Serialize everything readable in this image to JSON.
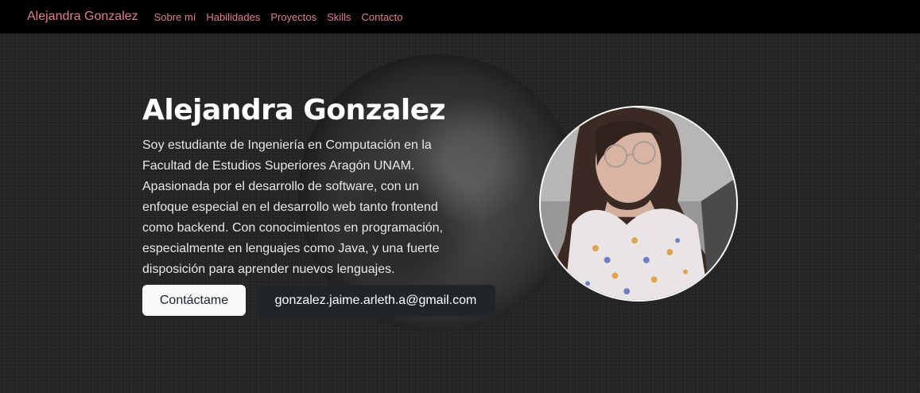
{
  "nav": {
    "brand": "Alejandra Gonzalez",
    "links": [
      "Sobre mí",
      "Habilidades",
      "Proyectos",
      "Skills",
      "Contacto"
    ]
  },
  "hero": {
    "title": "Alejandra Gonzalez",
    "description": "Soy estudiante de Ingeniería en Computación en la Facultad de Estudios Superiores Aragón UNAM. Apasionada por el desarrollo de software, con un enfoque especial en el desarrollo web tanto frontend como backend. Con conocimientos en programación, especialmente en lenguajes como Java, y una fuerte disposición para aprender nuevos lenguajes.",
    "contact_button": "Contáctame",
    "email_button": "gonzalez.jaime.arleth.a@gmail.com"
  },
  "colors": {
    "nav_bg": "#000000",
    "nav_link": "#e07f8c",
    "page_bg": "#272727",
    "button_light": "#f8f9fa",
    "button_dark": "#212529"
  },
  "icons": {
    "avatar": "profile-photo"
  }
}
